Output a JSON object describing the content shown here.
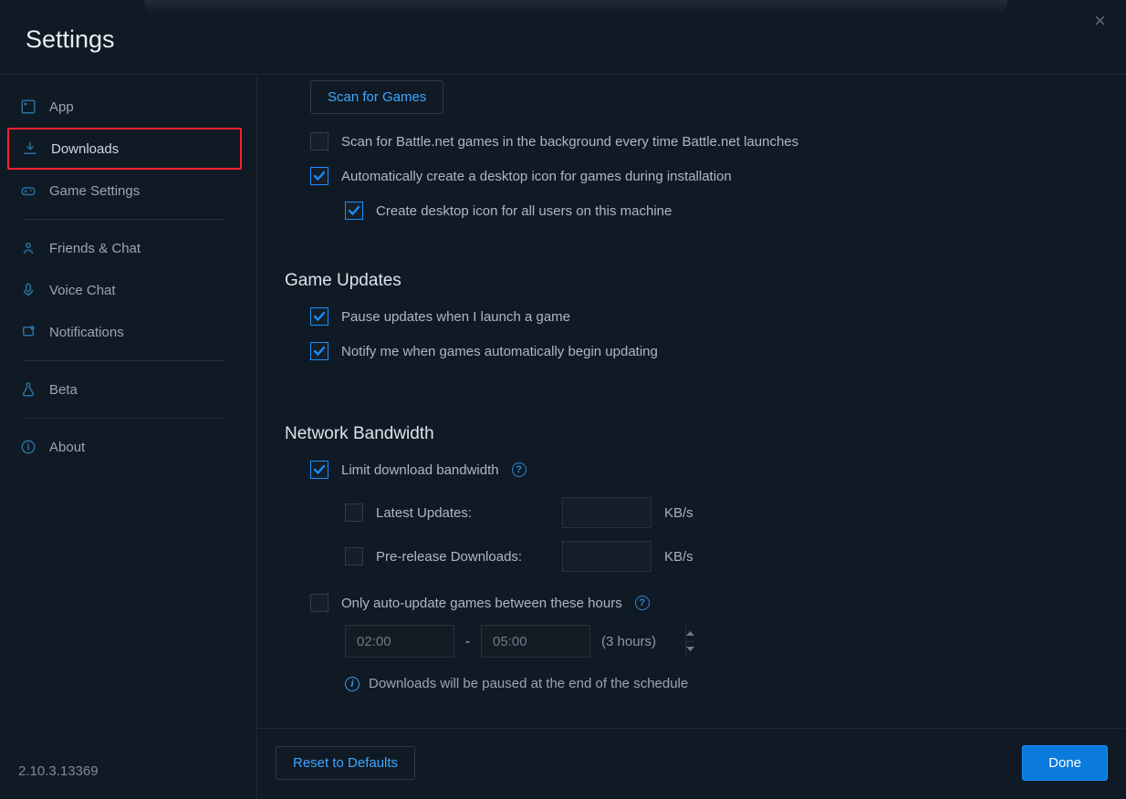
{
  "header": {
    "title": "Settings",
    "close": "×"
  },
  "sidebar": {
    "items": [
      {
        "label": "App"
      },
      {
        "label": "Downloads"
      },
      {
        "label": "Game Settings"
      },
      {
        "label": "Friends & Chat"
      },
      {
        "label": "Voice Chat"
      },
      {
        "label": "Notifications"
      },
      {
        "label": "Beta"
      },
      {
        "label": "About"
      }
    ],
    "version": "2.10.3.13369"
  },
  "content": {
    "scanBtn": "Scan for Games",
    "scanBackground": "Scan for Battle.net games in the background every time Battle.net launches",
    "desktopIcon": "Automatically create a desktop icon for games during installation",
    "desktopIconAll": "Create desktop icon for all users on this machine",
    "gameUpdates": {
      "heading": "Game Updates",
      "pause": "Pause updates when I launch a game",
      "notify": "Notify me when games automatically begin updating"
    },
    "bandwidth": {
      "heading": "Network Bandwidth",
      "limit": "Limit download bandwidth",
      "latest": "Latest Updates:",
      "prerelease": "Pre-release Downloads:",
      "unit": "KB/s",
      "schedule": "Only auto-update games between these hours",
      "from": "02:00",
      "to": "05:00",
      "duration": "(3 hours)",
      "separator": "-",
      "info": "Downloads will be paused at the end of the schedule"
    }
  },
  "footer": {
    "reset": "Reset to Defaults",
    "done": "Done"
  }
}
